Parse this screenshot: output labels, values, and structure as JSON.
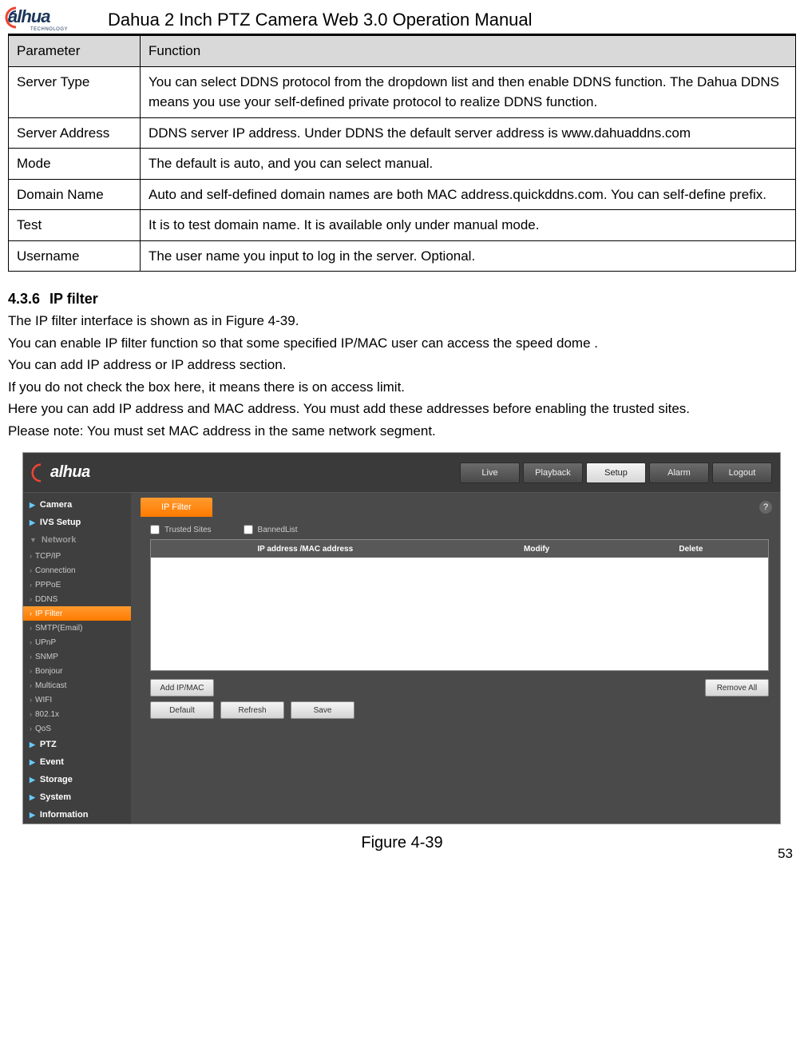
{
  "header": {
    "logo_main": "alhua",
    "logo_sub": "TECHNOLOGY",
    "doc_title": "Dahua 2 Inch PTZ Camera Web 3.0 Operation Manual"
  },
  "param_table": {
    "head_param": "Parameter",
    "head_func": "Function",
    "rows": [
      {
        "param": "Server Type",
        "func": "You can select DDNS protocol from the dropdown list and then enable DDNS function. The Dahua DDNS means you use your self-defined private protocol to realize DDNS function."
      },
      {
        "param": "Server Address",
        "func": "DDNS server IP address. Under DDNS the default server address is www.dahuaddns.com"
      },
      {
        "param": "Mode",
        "func": "The default is auto, and you can select manual."
      },
      {
        "param": "Domain Name",
        "func": "Auto and self-defined domain names are both MAC address.quickddns.com. You can self-define prefix."
      },
      {
        "param": "Test",
        "func": "It is to test domain name. It is available only under manual mode."
      },
      {
        "param": "Username",
        "func": "The user name you input to log in the server. Optional."
      }
    ]
  },
  "section": {
    "num": "4.3.6",
    "title": "IP filter",
    "paras": [
      "The IP filter interface is shown as in Figure 4-39.",
      "You can enable IP filter function so that some specified IP/MAC user can access the speed dome .",
      "You can add IP address or IP address section.",
      "If you do not check the box here, it means there is on access limit.",
      "Here you can add IP address and MAC address. You must add these addresses before enabling the trusted sites.",
      "Please note: You must set MAC address in the same network segment."
    ]
  },
  "screenshot": {
    "logo": "alhua",
    "tabs": [
      "Live",
      "Playback",
      "Setup",
      "Alarm",
      "Logout"
    ],
    "tabs_active_index": 2,
    "help": "?",
    "sidebar_top": [
      "Camera",
      "IVS Setup"
    ],
    "sidebar_network_label": "Network",
    "sidebar_network_items": [
      "TCP/IP",
      "Connection",
      "PPPoE",
      "DDNS",
      "IP Filter",
      "SMTP(Email)",
      "UPnP",
      "SNMP",
      "Bonjour",
      "Multicast",
      "WIFI",
      "802.1x",
      "QoS"
    ],
    "sidebar_network_active_index": 4,
    "sidebar_bottom": [
      "PTZ",
      "Event",
      "Storage",
      "System",
      "Information"
    ],
    "subtab": "IP Filter",
    "check1": "Trusted Sites",
    "check2": "BannedList",
    "table_heads": [
      "IP address /MAC address",
      "Modify",
      "Delete"
    ],
    "btn_add": "Add IP/MAC",
    "btn_remove": "Remove All",
    "btn_default": "Default",
    "btn_refresh": "Refresh",
    "btn_save": "Save"
  },
  "figure_caption": "Figure 4-39",
  "page_number": "53"
}
